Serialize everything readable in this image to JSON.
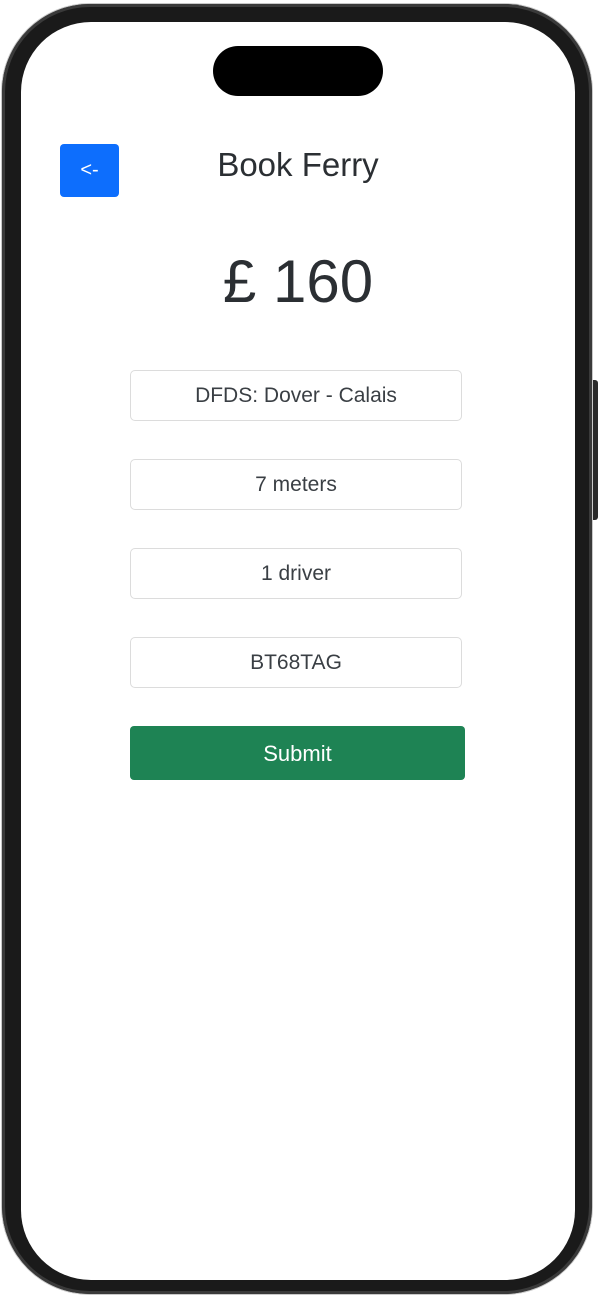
{
  "header": {
    "back_label": "<-",
    "title": "Book Ferry"
  },
  "price": "£ 160",
  "form": {
    "route": "DFDS: Dover - Calais",
    "vehicle_length": "7 meters",
    "drivers": "1 driver",
    "registration": "BT68TAG",
    "submit_label": "Submit"
  },
  "colors": {
    "back_button": "#0d6efd",
    "submit_button": "#1e8354",
    "text": "#2b2f33"
  }
}
